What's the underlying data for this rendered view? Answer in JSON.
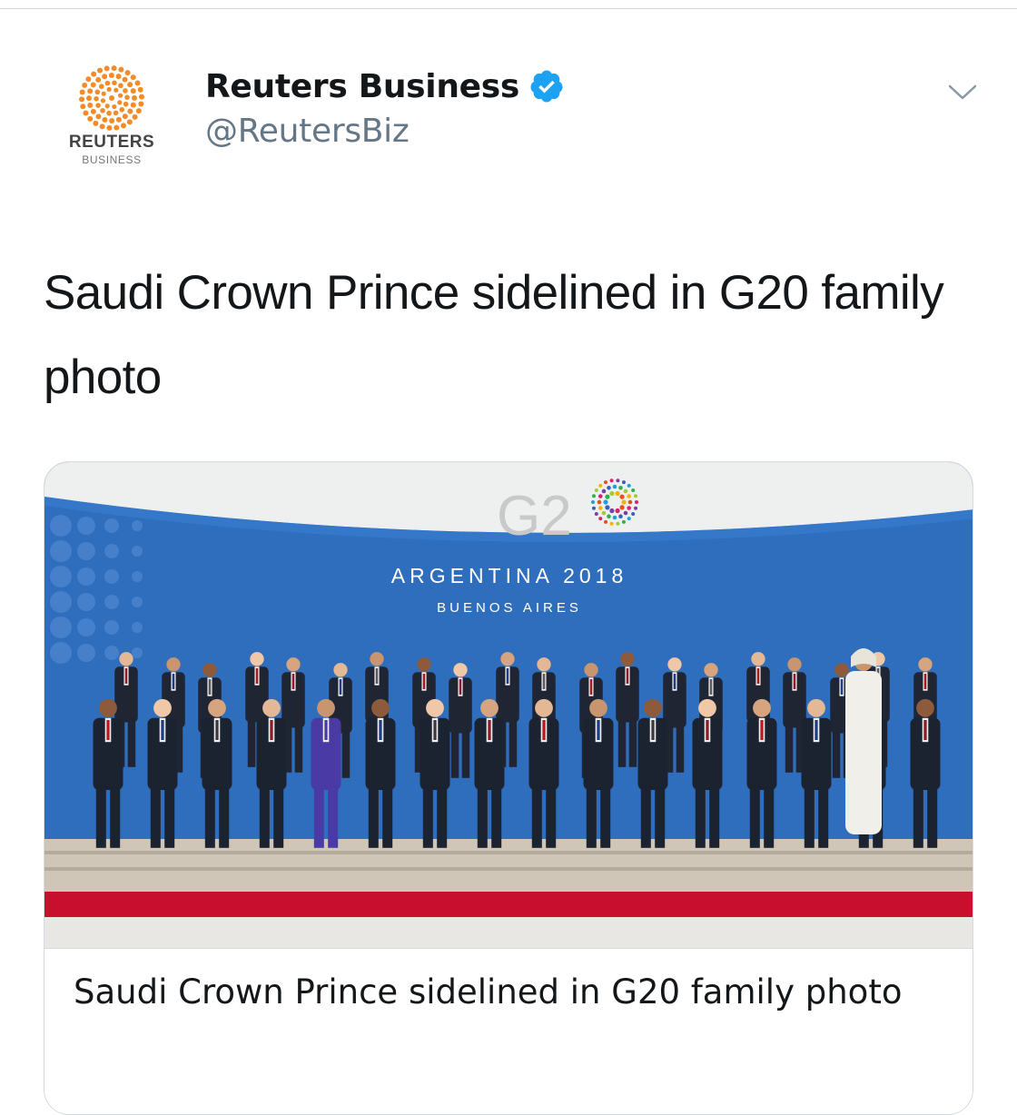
{
  "account": {
    "display_name": "Reuters Business",
    "handle": "@ReutersBiz",
    "verified": true,
    "avatar": {
      "icon": "reuters-logo-icon",
      "wordmark": "REUTERS",
      "subtext": "BUSINESS",
      "color": "#f28c28"
    }
  },
  "tweet": {
    "text": "Saudi Crown Prince sidelined in G20 family photo"
  },
  "menu": {
    "icon": "chevron-down-icon"
  },
  "card": {
    "image": {
      "icon": "g20-family-photo",
      "logo_text": "G2",
      "banner_line1": "ARGENTINA 2018",
      "banner_line2": "BUENOS AIRES"
    },
    "title": "Saudi Crown Prince sidelined in G20 family photo"
  },
  "colors": {
    "verified_blue": "#1da1f2",
    "handle_gray": "#657786",
    "banner_blue": "#2f6ebd",
    "carpet_red": "#c8102e"
  }
}
